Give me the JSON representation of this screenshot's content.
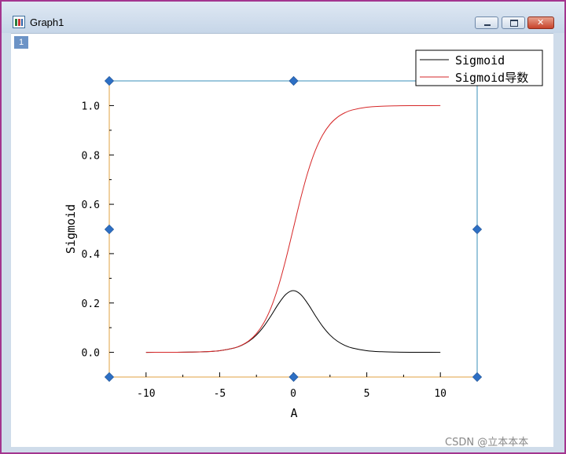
{
  "window": {
    "title": "Graph1",
    "layer_label": "1",
    "frame_color": "#a3358f"
  },
  "watermark": "CSDN @立本本本",
  "chart_data": {
    "type": "line",
    "xlabel": "A",
    "ylabel": "Sigmoid",
    "xlim": [
      -12.5,
      12.5
    ],
    "ylim": [
      -0.1,
      1.1
    ],
    "x_ticks": [
      -10,
      -5,
      0,
      5,
      10
    ],
    "x_tick_labels": [
      "-10",
      "-5",
      "0",
      "5",
      "10"
    ],
    "y_ticks": [
      0.0,
      0.2,
      0.4,
      0.6,
      0.8,
      1.0
    ],
    "y_tick_labels": [
      "0.0",
      "0.2",
      "0.4",
      "0.6",
      "0.8",
      "1.0"
    ],
    "grid": false,
    "legend_position": "top-right",
    "x": [
      -10,
      -9,
      -8,
      -7,
      -6,
      -5,
      -4,
      -3.5,
      -3,
      -2.5,
      -2,
      -1.5,
      -1,
      -0.5,
      0,
      0.5,
      1,
      1.5,
      2,
      2.5,
      3,
      3.5,
      4,
      5,
      6,
      7,
      8,
      9,
      10
    ],
    "series": [
      {
        "name": "Sigmoid",
        "color": "#000000",
        "values": [
          5e-05,
          0.00012,
          0.00034,
          0.00091,
          0.00247,
          0.00665,
          0.01766,
          0.02845,
          0.04518,
          0.0701,
          0.10499,
          0.14915,
          0.19661,
          0.235,
          0.25,
          0.235,
          0.19661,
          0.14915,
          0.10499,
          0.0701,
          0.04518,
          0.02845,
          0.01766,
          0.00665,
          0.00247,
          0.00091,
          0.00034,
          0.00012,
          5e-05
        ]
      },
      {
        "name": "Sigmoid导数",
        "color": "#d62728",
        "values": [
          5e-05,
          0.00012,
          0.00034,
          0.00091,
          0.00247,
          0.00669,
          0.01799,
          0.02931,
          0.04743,
          0.07586,
          0.1192,
          0.18243,
          0.26894,
          0.37754,
          0.5,
          0.62246,
          0.73106,
          0.81757,
          0.8808,
          0.92414,
          0.95257,
          0.97069,
          0.98201,
          0.99331,
          0.99753,
          0.99909,
          0.99966,
          0.99988,
          0.99995
        ]
      }
    ]
  }
}
